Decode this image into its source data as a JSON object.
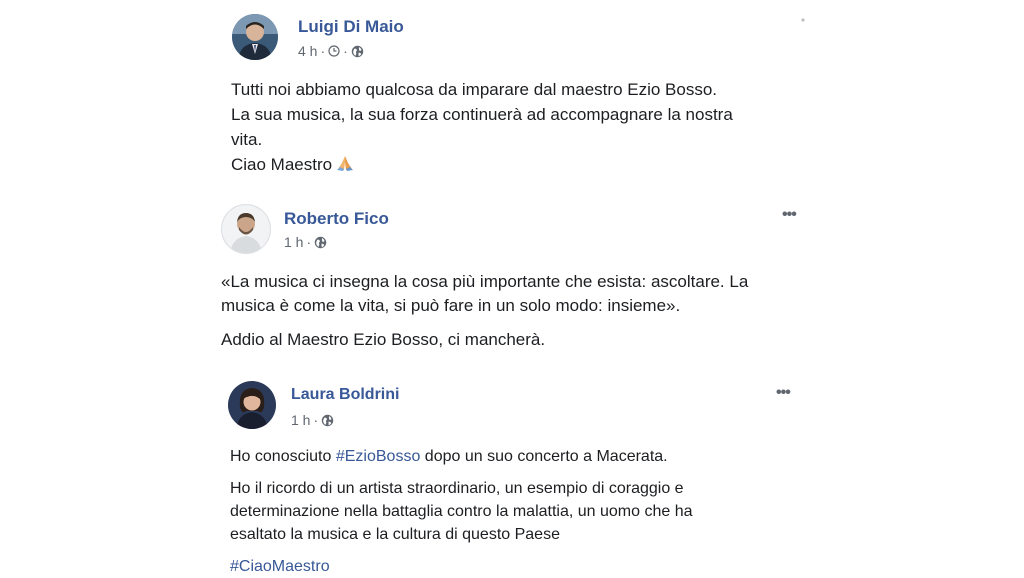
{
  "posts": [
    {
      "author": "Luigi Di Maio",
      "time": "4 h",
      "icons": [
        "clock-icon",
        "globe-icon"
      ],
      "lines": [
        "Tutti noi abbiamo qualcosa da imparare dal maestro Ezio Bosso.",
        "La sua musica, la sua forza continuerà ad accompagnare la nostra",
        "vita.",
        "Ciao Maestro"
      ],
      "emoji": "praying-hands-icon"
    },
    {
      "author": "Roberto Fico",
      "time": "1 h",
      "icons": [
        "globe-icon"
      ],
      "more": "•••",
      "lines": [
        "«La musica ci insegna la cosa più importante che esista: ascoltare. La",
        "musica è come la vita, si può fare in un solo modo: insieme».",
        "Addio al Maestro Ezio Bosso, ci mancherà."
      ]
    },
    {
      "author": "Laura Boldrini",
      "time": "1 h",
      "icons": [
        "globe-icon"
      ],
      "more": "•••",
      "line1_before": "Ho conosciuto ",
      "line1_hashtag": "#EzioBosso",
      "line1_after": " dopo un suo concerto a Macerata.",
      "lines": [
        "Ho il ricordo di un artista straordinario, un esempio di coraggio e",
        "determinazione nella battaglia contro la malattia, un uomo che ha",
        "esaltato la musica e la cultura di questo Paese"
      ],
      "hashtag2": "#CiaoMaestro"
    }
  ],
  "colors": {
    "link": "#385898",
    "text": "#1c1e21",
    "meta": "#606770"
  }
}
